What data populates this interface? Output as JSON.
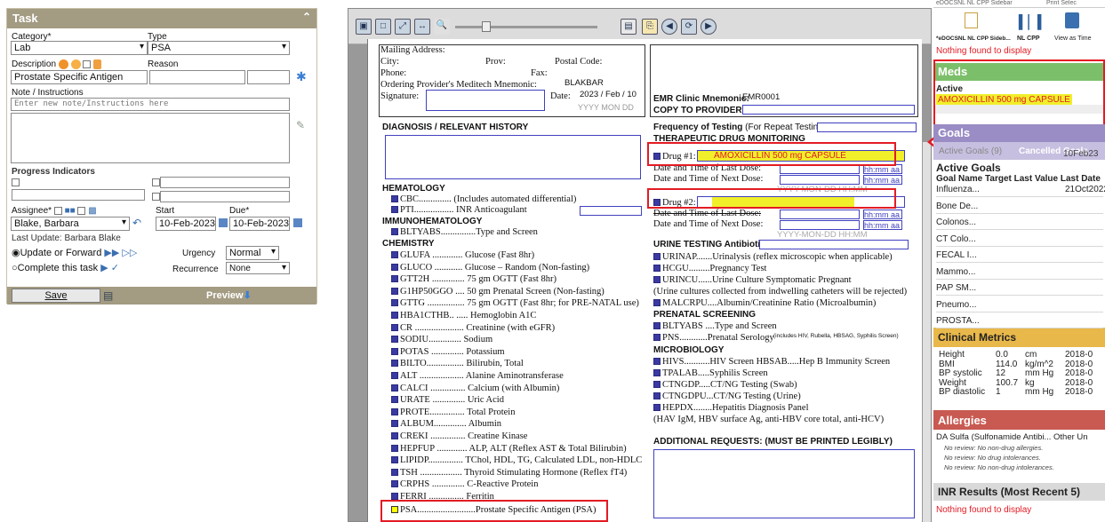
{
  "task": {
    "title": "Task",
    "category_label": "Category*",
    "category_value": "Lab",
    "type_label": "Type",
    "type_value": "PSA",
    "description_label": "Description",
    "description_value": "Prostate Specific Antigen",
    "reason_label": "Reason",
    "note_label": "Note / Instructions",
    "note_placeholder": "Enter new note/Instructions here",
    "progress_label": "Progress Indicators",
    "assignee_label": "Assignee*",
    "assignee_value": "Blake, Barbara",
    "start_label": "Start",
    "start_value": "10-Feb-2023",
    "due_label": "Due*",
    "due_value": "10-Feb-2023",
    "last_update": "Last Update: Barbara Blake",
    "update_option": "Update or Forward",
    "complete_option": "Complete this task",
    "urgency_label": "Urgency",
    "urgency_value": "Normal",
    "recurrence_label": "Recurrence",
    "recurrence_value": "None",
    "save_label": "Save",
    "preview_label": "Preview"
  },
  "form": {
    "mailing": "Mailing Address:",
    "city": "City:",
    "prov": "Prov:",
    "postal": "Postal Code:",
    "phone": "Phone:",
    "fax": "Fax:",
    "ordering": "Ordering Provider's Meditech Mnemonic:",
    "ordering_value": "BLAKBAR",
    "signature": "Signature:",
    "date_label": "Date:",
    "date_value": "2023 / Feb / 10",
    "date_hint": "YYYY    MON    DD",
    "emr": "EMR Clinic Mnemonic:",
    "emr_value": "EMR0001",
    "copy": "COPY TO PROVIDER",
    "diag": "DIAGNOSIS / RELEVANT  HISTORY",
    "freq": "Frequency of Testing",
    "freq_note": "(For Repeat Testing)",
    "tdm": "THERAPEUTIC DRUG MONITORING",
    "drug1_label": "Drug #1:",
    "drug1_value": "AMOXICILLIN 500 mg CAPSULE",
    "last_dose": "Date and Time of Last Dose:",
    "next_dose": "Date and Time of Next Dose:",
    "hhmm": "hh:mm aa",
    "drug2_label": "Drug #2:",
    "yyyy_hint": "YYYY-MON-DD        HH:MM",
    "hem": "HEMATOLOGY",
    "cbc": "CBC.............. (Includes automated differential)",
    "pti": "PTI.................  INR    Anticoagulant",
    "immuno": "IMMUNOHEMATOLOGY",
    "bltyabs": "BLTYABS...............Type and Screen",
    "chem": "CHEMISTRY",
    "chem_items": [
      "GLUFA ............. Glucose (Fast 8hr)",
      "GLUCO ............ Glucose – Random (Non-fasting)",
      "GTT2H .............. 75 gm OGTT (Fast 8hr)",
      "G1HP50GGO .... 50 gm  Prenatal Screen (Non-fasting)",
      "GTTG ................ 75 gm OGTT (Fast  8hr;  for PRE-NATAL use)",
      "HBA1CTHB.. ..... Hemoglobin A1C",
      "CR ..................... Creatinine (with eGFR)",
      "SODIU.............. Sodium",
      "POTAS .............. Potassium",
      "BILTO................ Bilirubin, Total",
      "ALT ................... Alanine Aminotransferase",
      "CALCI ............... Calcium (with Albumin)",
      "URATE .............. Uric Acid",
      "PROTE............... Total Protein",
      "ALBUM.............. Albumin",
      "CREKI ............... Creatine Kinase",
      "HEPFUP ............. ALP, ALT (Reflex AST & Total Bilirubin)",
      "LIPIDP............... TChol, HDL, TG, Calculated LDL, non-HDLC",
      "TSH .................. Thyroid Stimulating Hormone (Reflex fT4)",
      "CRPHS .............. C-Reactive Protein",
      "FERRI ............... Ferritin"
    ],
    "psa": "PSA.........................Prostate Specific Antigen (PSA)",
    "urine": "URINE TESTING  Antibiotics:",
    "urine_items": [
      "URINAP.......Urinalysis (reflex microscopic when applicable)",
      "HCGU.........Pregnancy Test",
      "URINCU......Urine Culture   Symptomatic   Pregnant",
      "(Urine cultures collected from indwelling catheters will be rejected)",
      "MALCRPU....Albumin/Creatinine Ratio (Microalbumin)"
    ],
    "prenatal": "PRENATAL SCREENING",
    "prenatal_items": [
      "BLTYABS ....Type and Screen",
      "PNS............Prenatal Serology"
    ],
    "prenatal_note": "(includes HIV, Rubella, HBSAG, Syphilis Screen)",
    "micro": "MICROBIOLOGY",
    "micro_items": [
      "HIVS...........HIV Screen      HBSAB.....Hep B Immunity Screen",
      "TPALAB.....Syphilis Screen",
      "CTNGDP.....CT/NG Testing (Swab)",
      "CTNGDPU...CT/NG Testing (Urine)",
      "HEPDX........Hepatitis Diagnosis Panel",
      "(HAV IgM, HBV surface Ag, anti-HBV core total, anti-HCV)"
    ],
    "additional": "ADDITIONAL REQUESTS: (MUST BE PRINTED LEGIBLY)"
  },
  "right": {
    "top_left_label": "*eDOCSNL NL CPP Sideb...",
    "top_mid_label": "NL CPP",
    "top_right_label": "View as Time",
    "top_banner": "eDOCSNL NL CPP Sidebar",
    "top_banner_right": "Print    Selec",
    "nothing1": "Nothing found to display",
    "meds_title": "Meds",
    "meds_active": "Active",
    "meds_item": "AMOXICILLIN 500 mg CAPSULE",
    "goals_title": "Goals",
    "goals_tab_active": "Active Goals (9)",
    "goals_tab_cancelled": "Cancelled Goals",
    "goals_date": "10Feb23",
    "active_goals": "Active Goals",
    "goals_cols": "Goal Name  Target  Last Value  Last Date",
    "goals_rows": [
      {
        "name": "Influenza...",
        "date": "21Oct2022"
      },
      {
        "name": "Bone De...",
        "date": ""
      },
      {
        "name": "Colonos...",
        "date": ""
      },
      {
        "name": "CT Colo...",
        "date": ""
      },
      {
        "name": "FECAL I...",
        "date": ""
      },
      {
        "name": "Mammo...",
        "date": ""
      },
      {
        "name": "PAP SM...",
        "date": ""
      },
      {
        "name": "Pneumo...",
        "date": ""
      },
      {
        "name": "PROSTA...",
        "date": ""
      }
    ],
    "metrics_title": "Clinical Metrics",
    "metrics": [
      {
        "name": "Height",
        "value": "0.0",
        "unit": "cm",
        "date": "2018-0"
      },
      {
        "name": "BMI",
        "value": "114.0",
        "unit": "kg/m^2",
        "date": "2018-0"
      },
      {
        "name": "BP systolic",
        "value": "12",
        "unit": "mm Hg",
        "date": "2018-0"
      },
      {
        "name": "Weight",
        "value": "100.7",
        "unit": "kg",
        "date": "2018-0"
      },
      {
        "name": "BP diastolic",
        "value": "1",
        "unit": "mm Hg",
        "date": "2018-0"
      }
    ],
    "allergies_title": "Allergies",
    "allergy_item": "DA Sulfa (Sulfonamide Antibi...  Other Un",
    "allergy_notes": [
      "No review: No non-drug allergies.",
      "No review: No drug intolerances.",
      "No review: No non-drug intolerances."
    ],
    "inr_title": "INR Results (Most Recent 5)",
    "nothing2": "Nothing found to display"
  },
  "colors": {
    "task_header": "#a39b82",
    "meds_header": "#7cbf6a",
    "goals_header": "#9a8cc4",
    "metrics_header": "#e8b84a",
    "allergies_header": "#c85a52",
    "highlight_red": "#e31b23",
    "highlight_yellow": "#f0ef2a"
  }
}
